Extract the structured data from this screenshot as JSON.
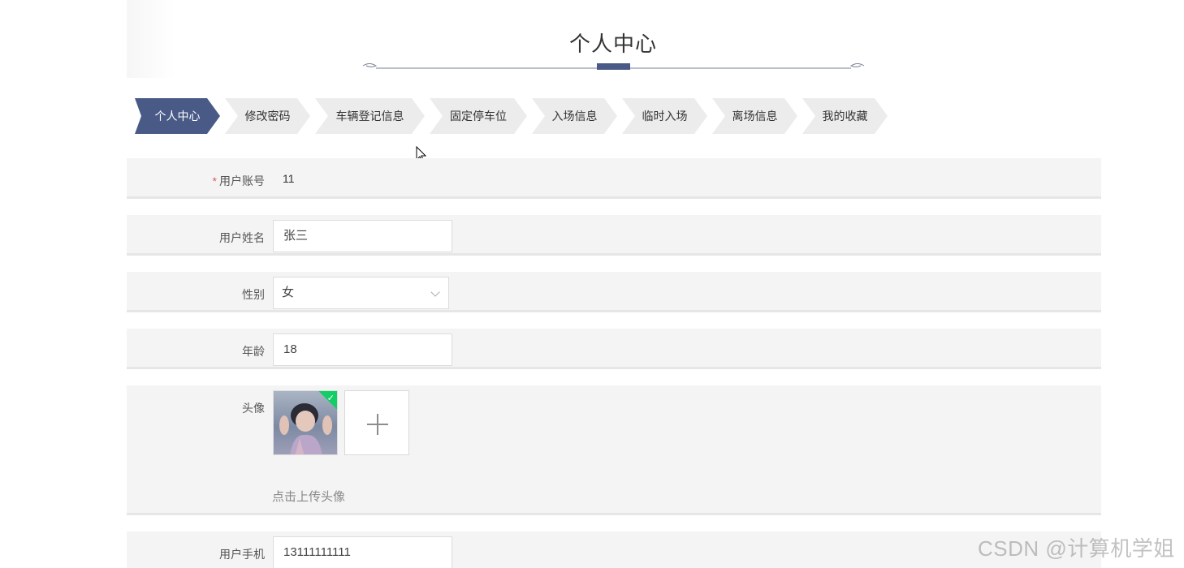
{
  "header": {
    "title": "个人中心"
  },
  "tabs": [
    {
      "label": "个人中心",
      "active": true
    },
    {
      "label": "修改密码"
    },
    {
      "label": "车辆登记信息"
    },
    {
      "label": "固定停车位"
    },
    {
      "label": "入场信息"
    },
    {
      "label": "临时入场"
    },
    {
      "label": "离场信息"
    },
    {
      "label": "我的收藏"
    }
  ],
  "form": {
    "account": {
      "label": "用户账号",
      "required_mark": "*",
      "value": "11"
    },
    "name": {
      "label": "用户姓名",
      "value": "张三"
    },
    "gender": {
      "label": "性别",
      "value": "女"
    },
    "age": {
      "label": "年龄",
      "value": "18"
    },
    "avatar": {
      "label": "头像",
      "upload_hint": "点击上传头像",
      "check_mark": "✓"
    },
    "phone": {
      "label": "用户手机",
      "value": "13111111111"
    }
  },
  "colors": {
    "accent": "#4a5a87",
    "tab_bg": "#ececec",
    "row_bg": "#f4f4f4",
    "success": "#13ce66",
    "required": "#e05c5c"
  },
  "watermark": "CSDN @计算机学姐"
}
